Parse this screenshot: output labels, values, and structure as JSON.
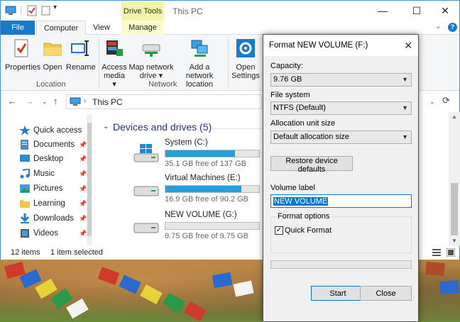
{
  "explorer": {
    "title": "This PC",
    "contextual_tab": "Drive Tools",
    "tabs": [
      "File",
      "Computer",
      "View",
      "Manage"
    ],
    "ribbon": {
      "buttons": [
        {
          "label": "Properties",
          "icon": "properties-icon"
        },
        {
          "label": "Open",
          "icon": "folder-open-icon"
        },
        {
          "label": "Rename",
          "icon": "rename-icon"
        },
        {
          "label_l1": "Access",
          "label_l2": "media ▾",
          "icon": "access-media-icon"
        },
        {
          "label_l1": "Map network",
          "label_l2": "drive ▾",
          "icon": "map-drive-icon"
        },
        {
          "label_l1": "Add a network",
          "label_l2": "location",
          "icon": "network-location-icon"
        },
        {
          "label_l1": "Open",
          "label_l2": "Settings",
          "icon": "settings-icon"
        }
      ],
      "groups": [
        "Location",
        "Network"
      ]
    },
    "address": "This PC",
    "nav": [
      {
        "label": "Quick access",
        "icon": "star-icon",
        "pinned": false
      },
      {
        "label": "Documents",
        "icon": "documents-icon",
        "pinned": true
      },
      {
        "label": "Desktop",
        "icon": "desktop-icon",
        "pinned": true
      },
      {
        "label": "Music",
        "icon": "music-icon",
        "pinned": true
      },
      {
        "label": "Pictures",
        "icon": "pictures-icon",
        "pinned": true
      },
      {
        "label": "Learning",
        "icon": "folder-icon",
        "pinned": true
      },
      {
        "label": "Downloads",
        "icon": "downloads-icon",
        "pinned": true
      },
      {
        "label": "Videos",
        "icon": "videos-icon",
        "pinned": true
      }
    ],
    "section_title": "Devices and drives (5)",
    "drives": [
      {
        "name": "System (C:)",
        "free": "35.1 GB free of 137 GB",
        "used_fraction": 0.74,
        "fill_color": "#26a0da",
        "windows": true
      },
      {
        "name": "Virtual Machines (E:)",
        "free": "16.9 GB free of 90.2 GB",
        "used_fraction": 0.81,
        "fill_color": "#26a0da",
        "windows": false
      },
      {
        "name": "NEW VOLUME (G:)",
        "free": "9.75 GB free of 9.75 GB",
        "used_fraction": 0.0,
        "fill_color": "#26a0da",
        "windows": false
      }
    ],
    "status": {
      "items": "12 items",
      "selected": "1 item selected"
    }
  },
  "dialog": {
    "title": "Format NEW VOLUME (F:)",
    "capacity_label": "Capacity:",
    "capacity_value": "9.76 GB",
    "filesystem_label": "File system",
    "filesystem_value": "NTFS (Default)",
    "alloc_label": "Allocation unit size",
    "alloc_value": "Default allocation size",
    "restore_button": "Restore device defaults",
    "volume_label": "Volume label",
    "volume_value": "NEW VOLUME",
    "format_options_label": "Format options",
    "quick_format_label": "Quick Format",
    "quick_format_checked": true,
    "progress": 0,
    "start_button": "Start",
    "close_button": "Close"
  },
  "colors": {
    "accent": "#1979ca",
    "drive_fill": "#26a0da",
    "section_title": "#1e3287",
    "contextual_tab": "#f4f4a8"
  }
}
